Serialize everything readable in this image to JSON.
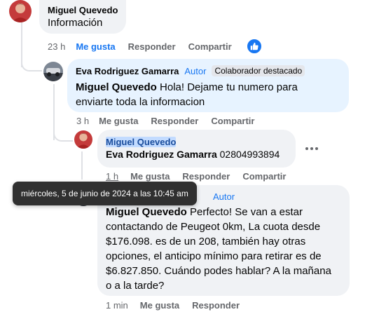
{
  "comments": [
    {
      "author": "Miguel Quevedo",
      "text": "Información",
      "time": "23 h",
      "actions": [
        "Me gusta",
        "Responder",
        "Compartir"
      ],
      "liked": true,
      "reaction": "like-icon"
    },
    {
      "author": "Eva Rodriguez Gamarra",
      "badge_author": "Autor",
      "badge_collab": "Colaborador destacado",
      "mention": "Miguel Quevedo",
      "text_line1": " Hola! Dejame tu numero para",
      "text_line2": "enviarte toda la informacion",
      "time": "3 h",
      "actions": [
        "Me gusta",
        "Responder",
        "Compartir"
      ]
    },
    {
      "author": "Miguel Quevedo",
      "mention": "Eva Rodriguez Gamarra",
      "text": " 02804993894",
      "time": "1 h",
      "actions": [
        "Me gusta",
        "Responder",
        "Compartir"
      ]
    },
    {
      "badge_author": "Autor",
      "mention": "Miguel Quevedo",
      "text_line1": " Perfecto! Se van a estar",
      "text_line2": "contactando de Peugeot 0km, La cuota desde",
      "text_line3": "$176.098. es de un 208, también hay otras",
      "text_line4": "opciones, el anticipo mínimo para retirar es de",
      "text_line5": "$6.827.850. Cuándo podes hablar? A la mañana",
      "text_line6": "o a la tarde?",
      "time": "1 min",
      "actions": [
        "Me gusta",
        "Responder"
      ]
    }
  ],
  "tooltip": "miércoles, 5 de junio de 2024 a las 10:45 am",
  "colors": {
    "accent": "#1877f2",
    "bubble": "#f0f2f5",
    "bubble_highlight": "#e7f3ff",
    "muted": "#65676b"
  }
}
